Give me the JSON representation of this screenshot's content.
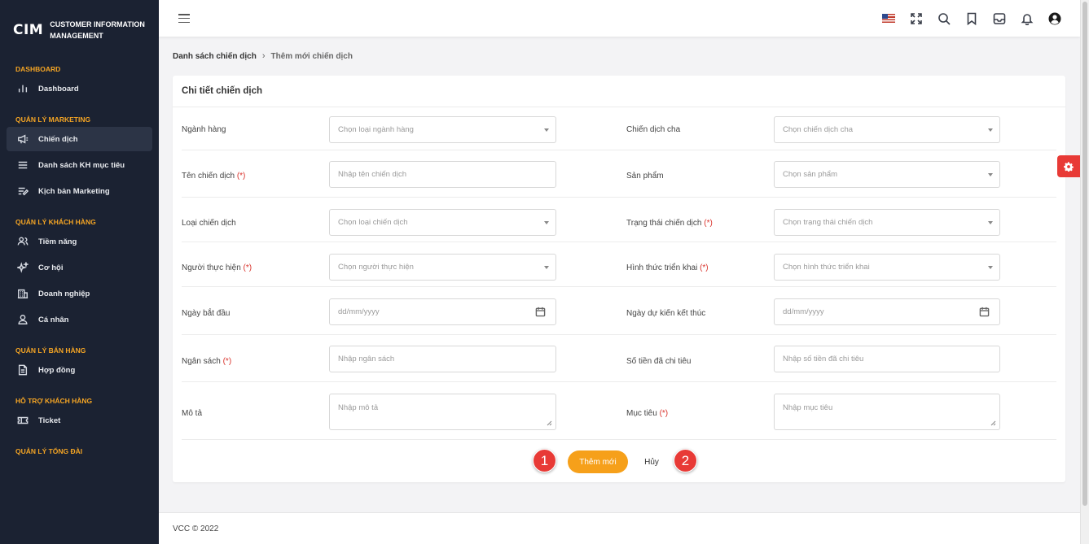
{
  "brand": {
    "logo": "CIM",
    "name": "CUSTOMER INFORMATION MANAGEMENT"
  },
  "sidebar": {
    "sections": [
      {
        "title": "DASHBOARD",
        "items": [
          {
            "label": "Dashboard",
            "icon": "bar-chart-icon"
          }
        ]
      },
      {
        "title": "QUẢN LÝ MARKETING",
        "items": [
          {
            "label": "Chiến dịch",
            "icon": "megaphone-icon",
            "active": true
          },
          {
            "label": "Danh sách KH mục tiêu",
            "icon": "list-icon"
          },
          {
            "label": "Kịch bản Marketing",
            "icon": "script-icon"
          }
        ]
      },
      {
        "title": "QUẢN LÝ KHÁCH HÀNG",
        "items": [
          {
            "label": "Tiềm năng",
            "icon": "users-icon"
          },
          {
            "label": "Cơ hội",
            "icon": "sparkle-icon"
          },
          {
            "label": "Doanh nghiệp",
            "icon": "building-icon"
          },
          {
            "label": "Cá nhân",
            "icon": "user-icon"
          }
        ]
      },
      {
        "title": "QUẢN LÝ BÁN HÀNG",
        "items": [
          {
            "label": "Hợp đồng",
            "icon": "document-icon"
          }
        ]
      },
      {
        "title": "HỖ TRỢ KHÁCH HÀNG",
        "items": [
          {
            "label": "Ticket",
            "icon": "ticket-icon"
          }
        ]
      },
      {
        "title": "QUẢN LÝ TỔNG ĐÀI",
        "items": []
      }
    ]
  },
  "header": {
    "icons": [
      "us-flag-icon",
      "fullscreen-icon",
      "search-icon",
      "bookmark-icon",
      "inbox-icon",
      "bell-icon",
      "account-icon"
    ]
  },
  "breadcrumb": {
    "parent": "Danh sách chiến dịch",
    "separator": "›",
    "current": "Thêm mới chiến dịch"
  },
  "card": {
    "title": "Chi tiết chiến dịch"
  },
  "form": {
    "nganh_hang": {
      "label": "Ngành hàng",
      "placeholder": "Chọn loại ngành hàng"
    },
    "chien_dich_cha": {
      "label": "Chiến dịch cha",
      "placeholder": "Chọn chiến dịch cha"
    },
    "ten_chien_dich": {
      "label": "Tên chiến dịch",
      "required": "(*)",
      "placeholder": "Nhập tên chiến dịch"
    },
    "san_pham": {
      "label": "Sản phẩm",
      "placeholder": "Chọn sản phẩm"
    },
    "loai_chien_dich": {
      "label": "Loại chiến dịch",
      "placeholder": "Chọn loại chiến dịch"
    },
    "trang_thai": {
      "label": "Trạng thái chiến dịch",
      "required": "(*)",
      "placeholder": "Chọn trạng thái chiến dịch"
    },
    "nguoi_thuc_hien": {
      "label": "Người thực hiện",
      "required": "(*)",
      "placeholder": "Chọn người thực hiện"
    },
    "hinh_thuc": {
      "label": "Hình thức triển khai",
      "required": "(*)",
      "placeholder": "Chọn hình thức triển khai"
    },
    "ngay_bat_dau": {
      "label": "Ngày bắt đầu",
      "placeholder": "dd/mm/yyyy"
    },
    "ngay_ket_thuc": {
      "label": "Ngày dự kiến kết thúc",
      "placeholder": "dd/mm/yyyy"
    },
    "ngan_sach": {
      "label": "Ngân sách",
      "required": "(*)",
      "placeholder": "Nhập ngân sách"
    },
    "so_tien": {
      "label": "Số tiền đã chi tiêu",
      "placeholder": "Nhập số tiền đã chi tiêu"
    },
    "mo_ta": {
      "label": "Mô tả",
      "placeholder": "Nhập mô tả"
    },
    "muc_tieu": {
      "label": "Mục tiêu",
      "required": "(*)",
      "placeholder": "Nhập mục tiêu"
    }
  },
  "actions": {
    "add_label": "Thêm mới",
    "cancel_label": "Hủy",
    "marker_1": "1",
    "marker_2": "2"
  },
  "footer": {
    "text": "VCC © 2022"
  },
  "colors": {
    "sidebar_bg": "#1b2232",
    "section_title": "#f5a524",
    "primary_button": "#f6a01a",
    "marker": "#e83a36",
    "required": "#d9322b"
  }
}
